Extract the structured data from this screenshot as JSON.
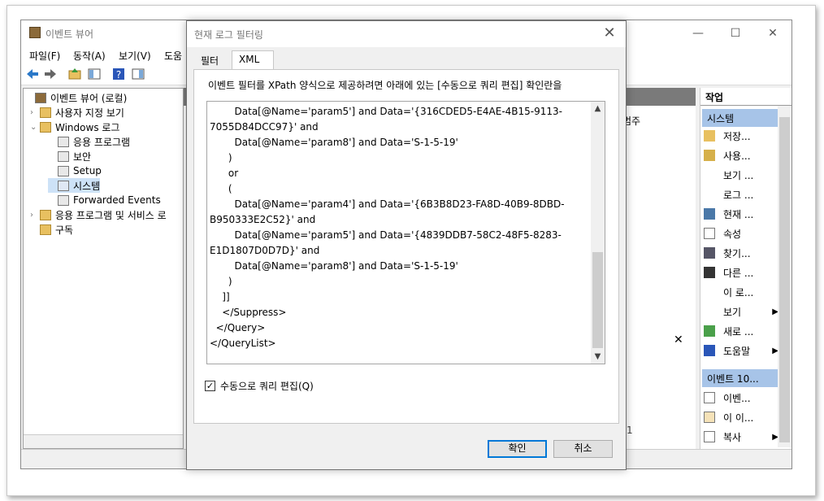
{
  "main_window": {
    "title": "이벤트 뷰어",
    "controls": {
      "minimize": "—",
      "maximize": "☐",
      "close": "✕"
    },
    "menu": [
      "파일(F)",
      "동작(A)",
      "보기(V)",
      "도움"
    ]
  },
  "tree": {
    "items": [
      {
        "label": "이벤트 뷰어 (로컬)",
        "arrow": ""
      },
      {
        "label": "사용자 지정 보기",
        "arrow": "›"
      },
      {
        "label": "Windows 로그",
        "arrow": "⌄"
      },
      {
        "label": "응용 프로그램",
        "arrow": ""
      },
      {
        "label": "보안",
        "arrow": ""
      },
      {
        "label": "Setup",
        "arrow": ""
      },
      {
        "label": "시스템",
        "arrow": ""
      },
      {
        "label": "Forwarded Events",
        "arrow": ""
      },
      {
        "label": "응용 프로그램 및 서비스 로",
        "arrow": "›"
      },
      {
        "label": "구독",
        "arrow": ""
      }
    ]
  },
  "middle": {
    "column_category": "범주",
    "close_mark": "✕",
    "bottom_text": "1"
  },
  "actions": {
    "header": "작업",
    "section1": "시스템",
    "section1_items": [
      "저장...",
      "사용...",
      "보기 ...",
      "로그 ...",
      "현재 ...",
      "속성",
      "찾기...",
      "다른 ...",
      "이 로...",
      "보기",
      "새로 ...",
      "도움말"
    ],
    "section2": "이벤트 10...",
    "section2_items": [
      "이벤...",
      "이 이...",
      "복사"
    ]
  },
  "dialog": {
    "title": "현재 로그 필터링",
    "tabs": [
      "필터",
      "XML"
    ],
    "instruction": "이벤트 필터를 XPath 양식으로 제공하려면 아래에 있는 [수동으로 쿼리 편집] 확인란을",
    "xml_lines": [
      "        Data[@Name='param5'] and Data='{316CDED5-E4AE-4B15-9113-",
      "7055D84DCC97}' and",
      "        Data[@Name='param8'] and Data='S-1-5-19'",
      "      )",
      "      or",
      "      (",
      "        Data[@Name='param4'] and Data='{6B3B8D23-FA8D-40B9-8DBD-",
      "B950333E2C52}' and",
      "        Data[@Name='param5'] and Data='{4839DDB7-58C2-48F5-8283-",
      "E1D1807D0D7D}' and",
      "        Data[@Name='param8'] and Data='S-1-5-19'",
      "      )",
      "    ]]",
      "    </Suppress>",
      "  </Query>",
      "</QueryList>"
    ],
    "checkbox_label": "수동으로 쿼리 편집(Q)",
    "checkbox_checked": "✓",
    "ok": "확인",
    "cancel": "취소"
  },
  "colors": {
    "accent": "#0078d7",
    "action_section": "#a7c4e8"
  }
}
